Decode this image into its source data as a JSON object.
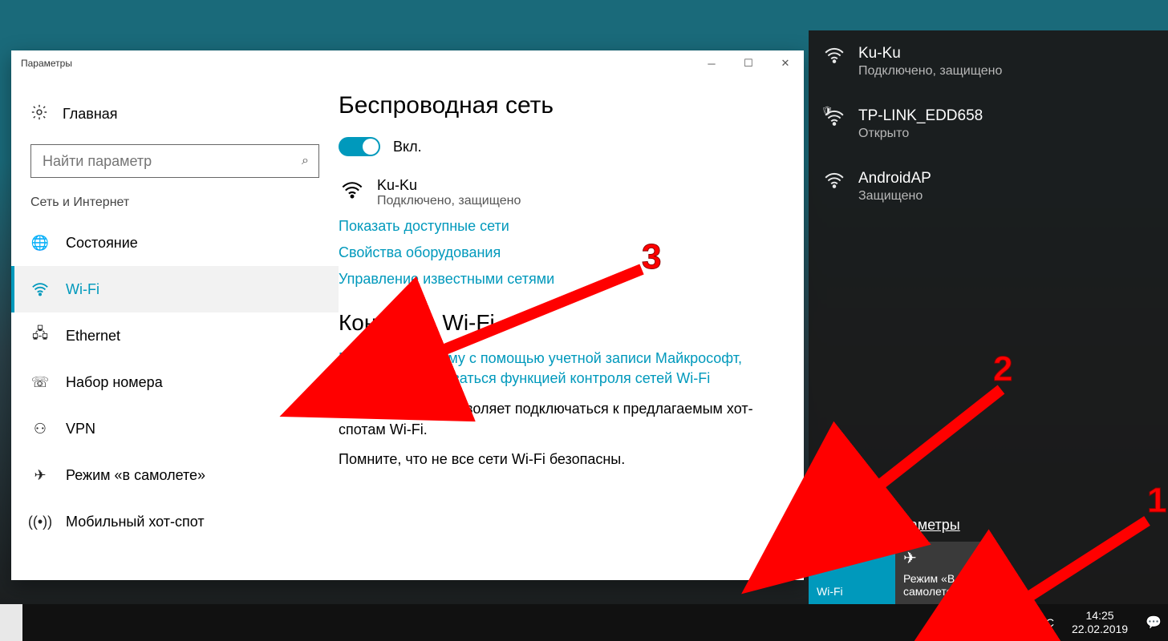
{
  "settings": {
    "title": "Параметры",
    "home": "Главная",
    "search_placeholder": "Найти параметр",
    "category": "Сеть и Интернет",
    "nav": [
      {
        "label": "Состояние"
      },
      {
        "label": "Wi-Fi"
      },
      {
        "label": "Ethernet"
      },
      {
        "label": "Набор номера"
      },
      {
        "label": "VPN"
      },
      {
        "label": "Режим «в самолете»"
      },
      {
        "label": "Мобильный хот-спот"
      }
    ],
    "content": {
      "h1": "Беспроводная сеть",
      "toggle_label": "Вкл.",
      "network": {
        "name": "Ku-Ku",
        "status": "Подключено, защищено"
      },
      "link_available": "Показать доступные сети",
      "link_hw": "Свойства оборудования",
      "link_known": "Управление известными сетями",
      "h2": "Контроль Wi-Fi",
      "ms_link": "Войдите в систему с помощью учетной записи Майкрософт, чтобы воспользоваться функцией контроля сетей Wi-Fi",
      "p1": "Контроль Wi-Fi позволяет подключаться к предлагаемым хот-спотам Wi-Fi.",
      "p2": "Помните, что не все сети Wi-Fi безопасны."
    }
  },
  "flyout": {
    "networks": [
      {
        "name": "Ku-Ku",
        "status": "Подключено, защищено",
        "shield": false
      },
      {
        "name": "TP-LINK_EDD658",
        "status": "Открыто",
        "shield": true
      },
      {
        "name": "AndroidAP",
        "status": "Защищено",
        "shield": false
      }
    ],
    "settings_link": "Сетевые параметры",
    "qa_wifi": "Wi-Fi",
    "qa_plane": "Режим «В самолете»"
  },
  "taskbar": {
    "lang": "РУС",
    "time": "14:25",
    "date": "22.02.2019"
  },
  "annotations": {
    "n1": "1",
    "n2": "2",
    "n3": "3"
  }
}
